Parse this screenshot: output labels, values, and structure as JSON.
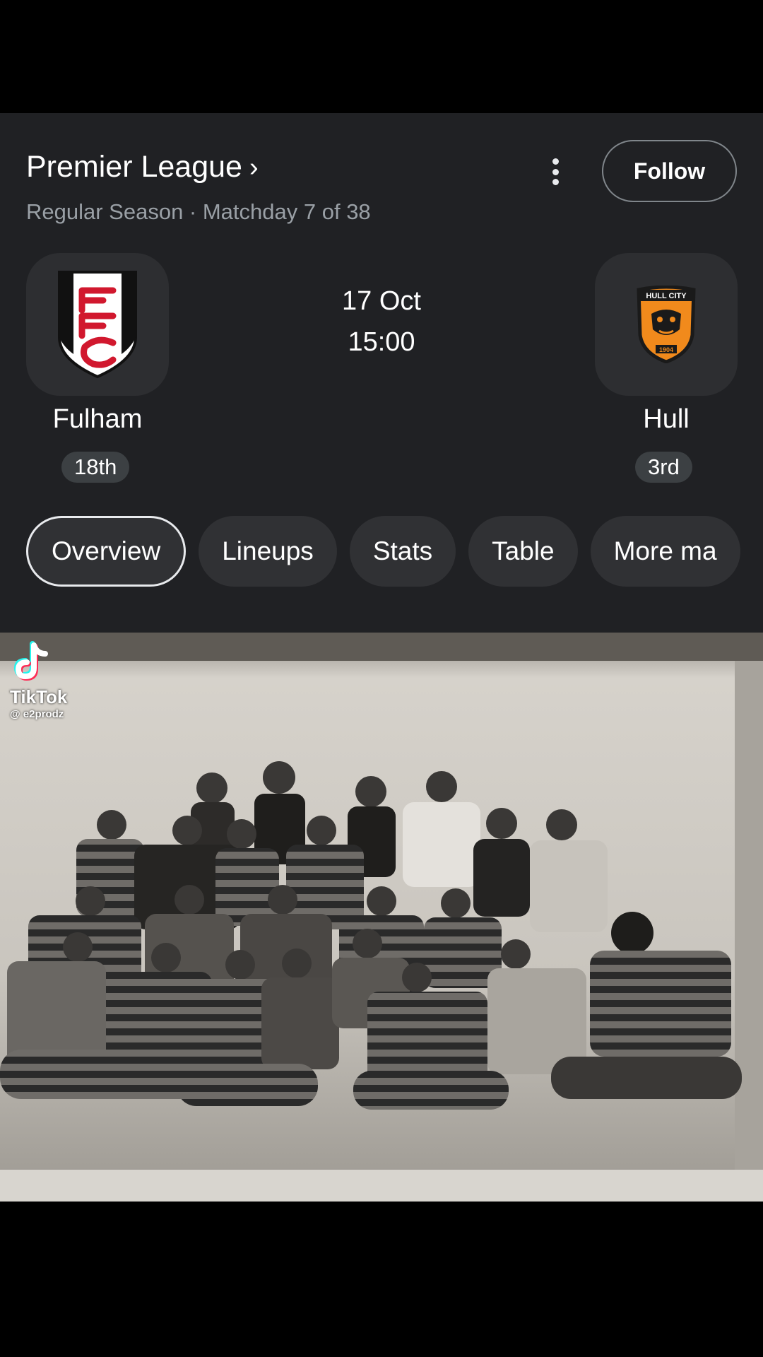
{
  "header": {
    "league": "Premier League",
    "chevron": "›",
    "subtitle": "Regular Season · Matchday 7 of 38",
    "follow_label": "Follow",
    "menu_icon": "more-vert-icon"
  },
  "match": {
    "date": "17 Oct",
    "time": "15:00",
    "home": {
      "name": "Fulham",
      "rank": "18th",
      "logo": "fulham-crest-icon",
      "color": "#d1182e"
    },
    "away": {
      "name": "Hull",
      "rank": "3rd",
      "logo": "hull-city-crest-icon",
      "color": "#f18a1c",
      "crest_text": "HULL CITY",
      "crest_year": "1904"
    }
  },
  "tabs": [
    "Overview",
    "Lineups",
    "Stats",
    "Table",
    "More ma"
  ],
  "active_tab": "Overview",
  "media": {
    "watermark": "TikTok",
    "username": "@ e2prodz"
  }
}
